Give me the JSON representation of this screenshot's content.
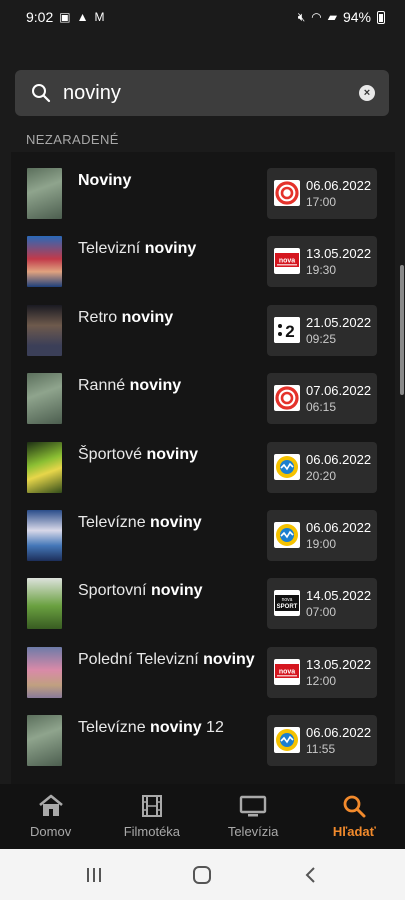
{
  "status_bar": {
    "time": "9:02",
    "battery": "94%"
  },
  "search": {
    "query": "noviny",
    "clear_label": "×"
  },
  "section": {
    "label": "NEZARADENÉ"
  },
  "results": [
    {
      "pre": "",
      "bold": "Noviny",
      "post": "",
      "channel_icon": "joj-logo-icon",
      "date": "06.06.2022",
      "time": "17:00"
    },
    {
      "pre": "Televizní ",
      "bold": "noviny",
      "post": "",
      "channel_icon": "nova-logo-icon",
      "date": "13.05.2022",
      "time": "19:30"
    },
    {
      "pre": "Retro ",
      "bold": "noviny",
      "post": "",
      "channel_icon": "stv2-logo-icon",
      "date": "21.05.2022",
      "time": "09:25"
    },
    {
      "pre": "Ranné ",
      "bold": "noviny",
      "post": "",
      "channel_icon": "joj-logo-icon",
      "date": "07.06.2022",
      "time": "06:15"
    },
    {
      "pre": "Športové ",
      "bold": "noviny",
      "post": "",
      "channel_icon": "ta3-logo-icon",
      "date": "06.06.2022",
      "time": "20:20"
    },
    {
      "pre": "Televízne ",
      "bold": "noviny",
      "post": "",
      "channel_icon": "ta3-logo-icon",
      "date": "06.06.2022",
      "time": "19:00"
    },
    {
      "pre": "Sportovní ",
      "bold": "noviny",
      "post": "",
      "channel_icon": "nova-sport-logo-icon",
      "date": "14.05.2022",
      "time": "07:00"
    },
    {
      "pre": "Polední Televizní ",
      "bold": "noviny",
      "post": "",
      "channel_icon": "nova-logo-icon",
      "date": "13.05.2022",
      "time": "12:00"
    },
    {
      "pre": "Televízne ",
      "bold": "noviny",
      "post": " 12",
      "channel_icon": "ta3-logo-icon",
      "date": "06.06.2022",
      "time": "11:55"
    }
  ],
  "nav": {
    "home": "Domov",
    "movies": "Filmotéka",
    "tv": "Televízia",
    "search": "Hľadať"
  },
  "colors": {
    "accent": "#f28a2c",
    "joj_red": "#e4322b",
    "nova_red": "#d5161f",
    "ta3_blue": "#1b7fd0",
    "ta3_yellow": "#f5c200"
  }
}
